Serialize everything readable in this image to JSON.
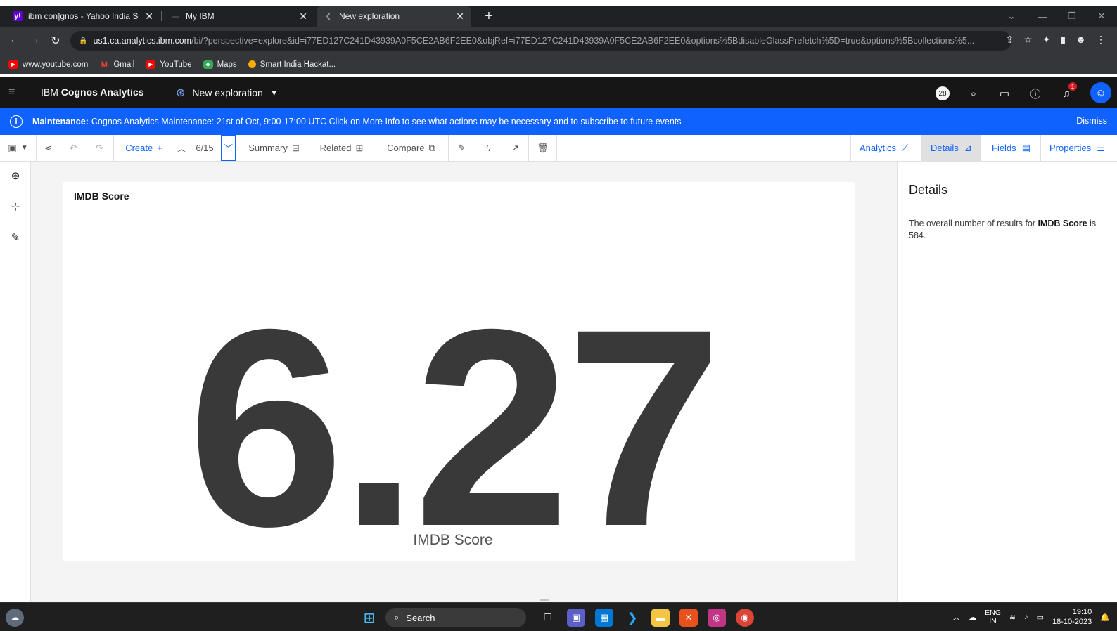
{
  "browser": {
    "tabs": [
      {
        "label": "ibm con]gnos - Yahoo India Sea",
        "active": false
      },
      {
        "label": "My IBM",
        "active": false
      },
      {
        "label": "New exploration",
        "active": true
      }
    ],
    "url_host": "us1.ca.analytics.ibm.com",
    "url_path": "/bi/?perspective=explore&id=i77ED127C241D43939A0F5CE2AB6F2EE0&objRef=i77ED127C241D43939A0F5CE2AB6F2EE0&options%5BdisableGlassPrefetch%5D=true&options%5Bcollections%5...",
    "bookmarks": [
      {
        "label": "www.youtube.com"
      },
      {
        "label": "Gmail"
      },
      {
        "label": "YouTube"
      },
      {
        "label": "Maps"
      },
      {
        "label": "Smart India Hackat..."
      }
    ]
  },
  "app": {
    "brand_prefix": "IBM",
    "brand_name": "Cognos Analytics",
    "exploration_title": "New exploration",
    "badge_count": "28",
    "notification_count": "1"
  },
  "banner": {
    "label": "Maintenance:",
    "message": "Cognos Analytics Maintenance: 21st of Oct, 9:00-17:00 UTC Click on More Info to see what actions may be necessary and to subscribe to future events",
    "dismiss": "Dismiss"
  },
  "toolbar": {
    "create": "Create",
    "counter": "6/15",
    "summary": "Summary",
    "related": "Related",
    "compare": "Compare",
    "right_tabs": {
      "analytics": "Analytics",
      "details": "Details",
      "fields": "Fields",
      "properties": "Properties"
    }
  },
  "card": {
    "title": "IMDB Score",
    "value": "6.27",
    "value_label": "IMDB Score"
  },
  "details_panel": {
    "heading": "Details",
    "text_prefix": "The overall number of results for",
    "text_bold": "IMDB Score",
    "text_suffix": "is 584."
  },
  "taskbar": {
    "search": "Search",
    "lang_top": "ENG",
    "lang_bottom": "IN",
    "time": "19:10",
    "date": "18-10-2023"
  },
  "colors": {
    "accent": "#0f62fe",
    "header_bg": "#161616",
    "banner_bg": "#0f62fe",
    "value_text": "#393939"
  }
}
